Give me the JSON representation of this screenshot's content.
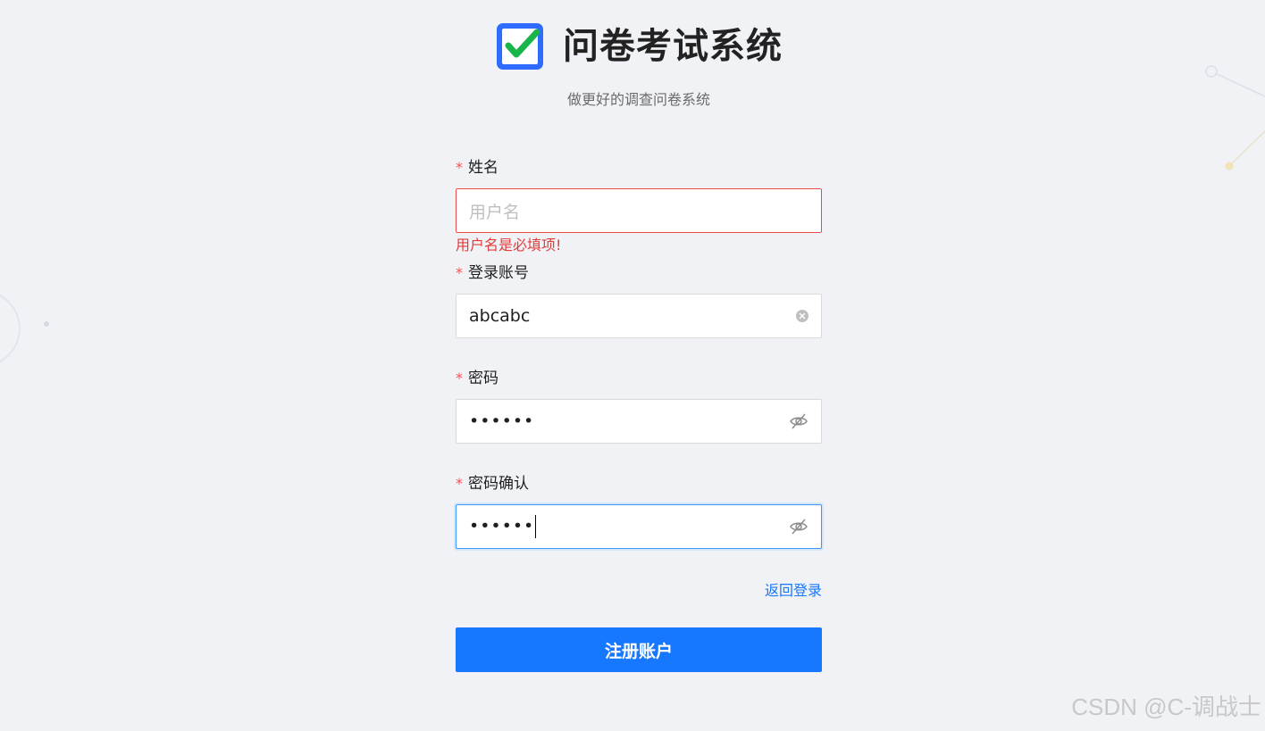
{
  "app": {
    "title": "问卷考试系统",
    "subtitle": "做更好的调查问卷系统"
  },
  "form": {
    "name": {
      "label": "姓名",
      "required_mark": "*",
      "placeholder": "用户名",
      "value": "",
      "error": "用户名是必填项!"
    },
    "account": {
      "label": "登录账号",
      "required_mark": "*",
      "value": "abcabc"
    },
    "password": {
      "label": "密码",
      "required_mark": "*",
      "masked_value": "••••••"
    },
    "password_confirm": {
      "label": "密码确认",
      "required_mark": "*",
      "masked_value": "••••••"
    },
    "back_link": "返回登录",
    "submit_label": "注册账户"
  },
  "watermark": "CSDN @C-调战士",
  "colors": {
    "primary": "#1677ff",
    "error": "#e23b3b",
    "background": "#f0f2f5",
    "logo_blue": "#2f6bff",
    "logo_check": "#19b44a"
  },
  "icons": {
    "logo": "checkbox-logo-icon",
    "clear": "clear-circle-icon",
    "password_toggle": "eye-invisible-icon"
  }
}
